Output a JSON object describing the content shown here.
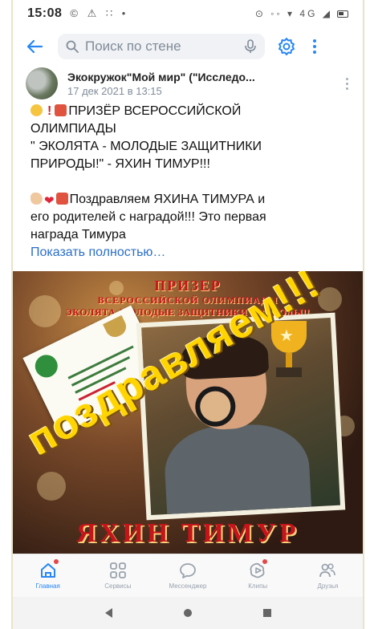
{
  "status_bar": {
    "time": "15:08",
    "left_icons": "© ⚠ ∷ •",
    "right_icons": "⊙ ◦◦ ▾ 4G ◢"
  },
  "toolbar": {
    "search_placeholder": "Поиск по стене"
  },
  "post": {
    "author": "Экокружок\"Мой мир\" (\"Исследо...",
    "date": "17 дек 2021 в 13:15",
    "lines": [
      "ПРИЗЁР ВСЕРОССИЙСКОЙ",
      "ОЛИМПИАДЫ",
      "\" ЭКОЛЯТА - МОЛОДЫЕ ЗАЩИТНИКИ",
      "ПРИРОДЫ!\" - ЯХИН ТИМУР!!!",
      "Поздравляем ЯХИНА ТИМУРА и",
      "его родителей с наградой!!! Это первая",
      "награда Тимура"
    ],
    "exclaim": "!",
    "show_more": "Показать полностью…",
    "image": {
      "title1": "ПРИЗЕР",
      "title2": "ВСЕРОССИЙСКОЙ ОЛИМПИАДЫ",
      "title3": "ЭКОЛЯТА-МОЛОДЫЕ ЗАЩИТНИКИ ПРИРОДЫ!!",
      "congrats": "поздравляем!!!",
      "name": "ЯХИН ТИМУР"
    }
  },
  "bottom_nav": {
    "items": [
      {
        "label": "Главная",
        "icon": "home-icon",
        "active": true,
        "badge": true
      },
      {
        "label": "Сервисы",
        "icon": "services-icon",
        "active": false,
        "badge": false
      },
      {
        "label": "Мессенджер",
        "icon": "messenger-icon",
        "active": false,
        "badge": false
      },
      {
        "label": "Клипы",
        "icon": "clips-icon",
        "active": false,
        "badge": true
      },
      {
        "label": "Друзья",
        "icon": "friends-icon",
        "active": false,
        "badge": false
      }
    ]
  },
  "colors": {
    "accent": "#2787f5",
    "link": "#2a6fc9",
    "muted": "#818c99",
    "badge": "#e64646"
  }
}
